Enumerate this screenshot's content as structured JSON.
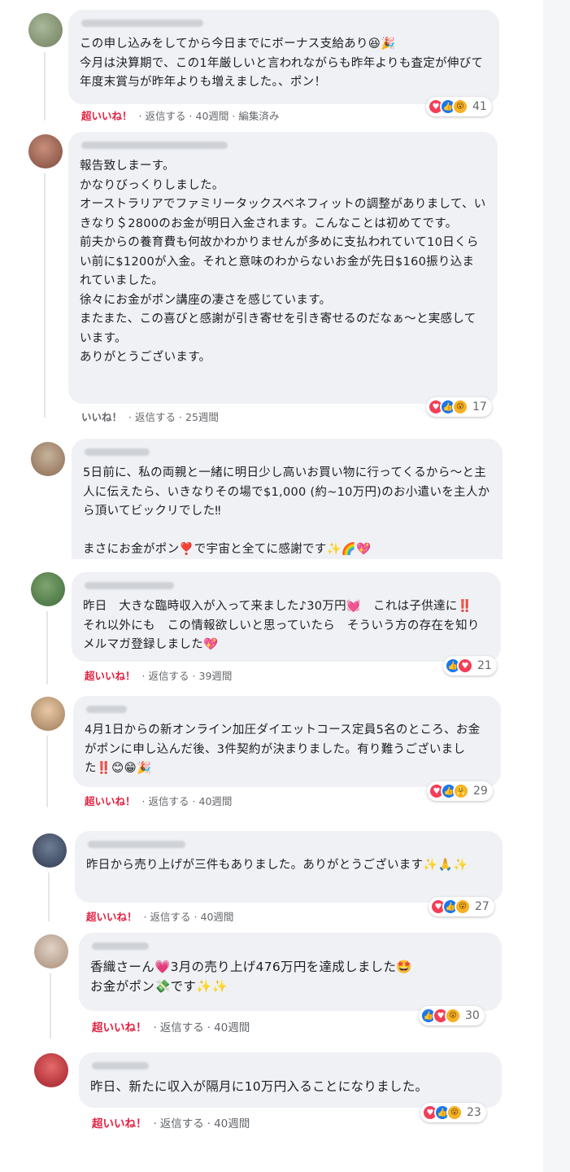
{
  "comments": [
    {
      "text": "この申し込みをしてから今日までにボーナス支給あり😆🎉\n今月は決算期で、この1年厳しいと言われながらも昨年よりも査定が伸びて年度末賞与が昨年よりも増えました。、ポン！",
      "like": "超いいね！",
      "reply": "返信する",
      "time": "40週間",
      "edited": "編集済み",
      "count": "41",
      "reactions": [
        "love",
        "like",
        "wow"
      ]
    },
    {
      "text": "報告致しまーす。\nかなりびっくりしました。\nオーストラリアでファミリータックスベネフィットの調整がありまして、いきなり＄2800のお金が明日入金されます。こんなことは初めてです。\n前夫からの養育費も何故かわかりませんが多めに支払われていて10日くらい前に$1200が入金。それと意味のわからないお金が先日$160振り込まれていました。\n徐々にお金がポン講座の凄さを感じています。\nまたまた、この喜びと感謝が引き寄せを引き寄せるのだなぁ〜と実感しています。\nありがとうございます。",
      "like": "いいね！",
      "reply": "返信する",
      "time": "25週間",
      "count": "17",
      "reactions": [
        "love",
        "like",
        "wow"
      ]
    },
    {
      "text": "5日前に、私の両親と一緒に明日少し高いお買い物に行ってくるから〜と主人に伝えたら、いきなりその場で$1,000 (約~10万円)のお小遣いを主人から頂いてビックリでした‼\n\nまさにお金がポン❣️で宇宙と全てに感謝です✨🌈💖"
    },
    {
      "text": "昨日　大きな臨時収入が入って来ました♪30万円💓　これは子供達に‼️　それ以外にも　この情報欲しいと思っていたら　そういう方の存在を知りメルマガ登録しました💖",
      "like": "超いいね！",
      "reply": "返信する",
      "time": "39週間",
      "count": "21",
      "reactions": [
        "like",
        "love"
      ]
    },
    {
      "text": "4月1日からの新オンライン加圧ダイエットコース定員5名のところ、お金がポンに申し込んだ後、3件契約が決まりました。有り難うございました‼️😊😁🎉",
      "like": "超いいね！",
      "reply": "返信する",
      "time": "40週間",
      "count": "29",
      "reactions": [
        "love",
        "like",
        "care"
      ]
    },
    {
      "text": "昨日から売り上げが三件もありました。ありがとうございます✨🙏✨",
      "like": "超いいね！",
      "reply": "返信する",
      "time": "40週間",
      "count": "27",
      "reactions": [
        "love",
        "like",
        "wow"
      ]
    },
    {
      "text": "香織さーん💗3月の売り上げ476万円を達成しました🤩\nお金がポン💸です✨✨",
      "like": "超いいね！",
      "reply": "返信する",
      "time": "40週間",
      "count": "30",
      "reactions": [
        "like",
        "love",
        "wow"
      ]
    },
    {
      "text": "昨日、新たに収入が隔月に10万円入ることになりました。",
      "like": "超いいね！",
      "reply": "返信する",
      "time": "40週間",
      "count": "23",
      "reactions": [
        "love",
        "like",
        "wow"
      ]
    }
  ],
  "colors": {
    "bubble": "#eff1f4",
    "like_active": "#e41e3f",
    "meta": "#65676b",
    "love": "#f33e58",
    "like": "#1877f2",
    "wow": "#f7b125"
  },
  "icons": {
    "love": "heart-reaction-icon",
    "like": "thumbs-up-reaction-icon",
    "wow": "wow-reaction-icon",
    "care": "care-reaction-icon"
  }
}
